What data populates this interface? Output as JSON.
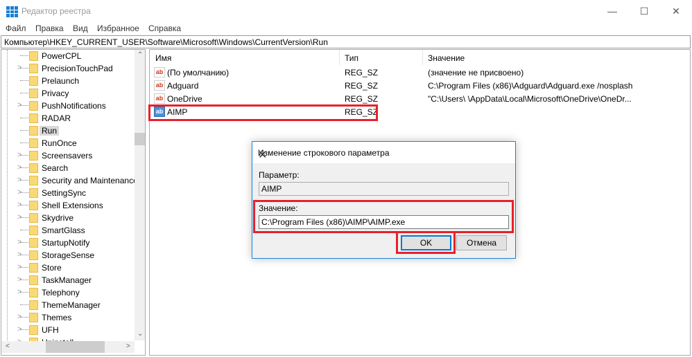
{
  "window": {
    "title": "Редактор реестра",
    "controls": [
      "—",
      "☐",
      "✕"
    ]
  },
  "menu": [
    "Файл",
    "Правка",
    "Вид",
    "Избранное",
    "Справка"
  ],
  "address": "Компьютер\\HKEY_CURRENT_USER\\Software\\Microsoft\\Windows\\CurrentVersion\\Run",
  "tree": {
    "items": [
      {
        "label": "PowerCPL",
        "expandable": false
      },
      {
        "label": "PrecisionTouchPad",
        "expandable": true
      },
      {
        "label": "Prelaunch",
        "expandable": false
      },
      {
        "label": "Privacy",
        "expandable": false
      },
      {
        "label": "PushNotifications",
        "expandable": true
      },
      {
        "label": "RADAR",
        "expandable": false
      },
      {
        "label": "Run",
        "expandable": false,
        "selected": true
      },
      {
        "label": "RunOnce",
        "expandable": false
      },
      {
        "label": "Screensavers",
        "expandable": true
      },
      {
        "label": "Search",
        "expandable": true
      },
      {
        "label": "Security and Maintenance",
        "expandable": true
      },
      {
        "label": "SettingSync",
        "expandable": true
      },
      {
        "label": "Shell Extensions",
        "expandable": true
      },
      {
        "label": "Skydrive",
        "expandable": true
      },
      {
        "label": "SmartGlass",
        "expandable": false
      },
      {
        "label": "StartupNotify",
        "expandable": true
      },
      {
        "label": "StorageSense",
        "expandable": true
      },
      {
        "label": "Store",
        "expandable": true
      },
      {
        "label": "TaskManager",
        "expandable": true
      },
      {
        "label": "Telephony",
        "expandable": true
      },
      {
        "label": "ThemeManager",
        "expandable": false
      },
      {
        "label": "Themes",
        "expandable": true
      },
      {
        "label": "UFH",
        "expandable": true
      },
      {
        "label": "Uninstall",
        "expandable": true
      }
    ]
  },
  "list": {
    "columns": [
      "Имя",
      "Тип",
      "Значение"
    ],
    "rows": [
      {
        "icon": "ab",
        "name": "(По умолчанию)",
        "type": "REG_SZ",
        "data": "(значение не присвоено)"
      },
      {
        "icon": "ab",
        "name": "Adguard",
        "type": "REG_SZ",
        "data": "C:\\Program Files (x86)\\Adguard\\Adguard.exe /nosplash"
      },
      {
        "icon": "ab",
        "name": "OneDrive",
        "type": "REG_SZ",
        "data": "\"C:\\Users\\                \\AppData\\Local\\Microsoft\\OneDrive\\OneDr..."
      },
      {
        "icon": "ab",
        "name": "AIMP",
        "type": "REG_SZ",
        "data": "",
        "selected": true
      }
    ]
  },
  "dialog": {
    "title": "Изменение строкового параметра",
    "param_label": "Параметр:",
    "param_value": "AIMP",
    "value_label": "Значение:",
    "value_value": "C:\\Program Files (x86)\\AIMP\\AIMP.exe",
    "ok": "OK",
    "cancel": "Отмена",
    "close": "✕"
  },
  "colors": {
    "highlight": "#e8202a",
    "accent": "#0078d7"
  }
}
